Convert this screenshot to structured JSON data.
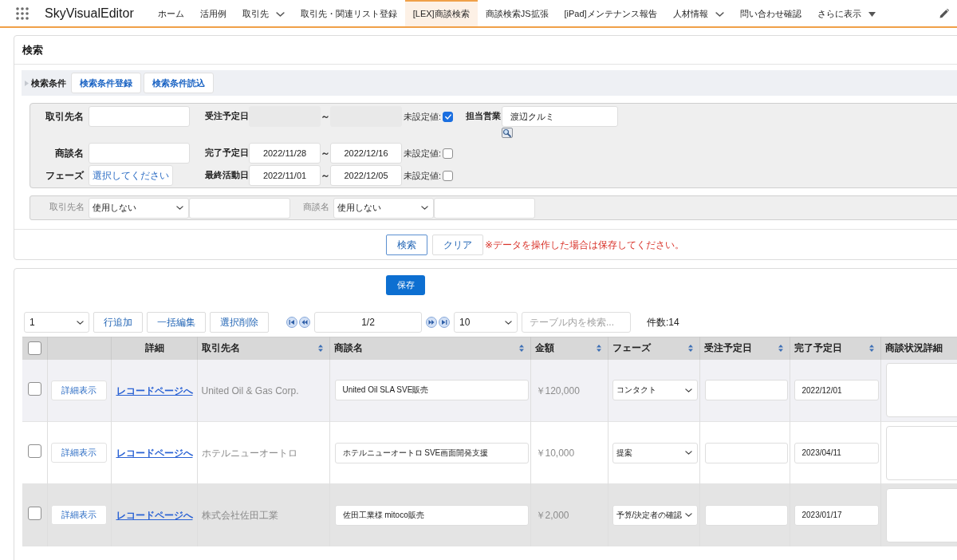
{
  "app": {
    "name": "SkyVisualEditor"
  },
  "nav": [
    {
      "label": "ホーム",
      "kind": "link",
      "selected": false
    },
    {
      "label": "活用例",
      "kind": "link",
      "selected": false
    },
    {
      "label": "取引先",
      "kind": "menu",
      "selected": false
    },
    {
      "label": "取引先・関連リスト登録",
      "kind": "link",
      "selected": false
    },
    {
      "label": "[LEX]商談検索",
      "kind": "link",
      "selected": true
    },
    {
      "label": "商談検索JS拡張",
      "kind": "link",
      "selected": false
    },
    {
      "label": "[iPad]メンテナンス報告",
      "kind": "link",
      "selected": false
    },
    {
      "label": "人材情報",
      "kind": "menu",
      "selected": false
    },
    {
      "label": "問い合わせ確認",
      "kind": "link",
      "selected": false
    },
    {
      "label": "さらに表示",
      "kind": "more",
      "selected": false
    }
  ],
  "search": {
    "title": "検索",
    "conditions": {
      "label": "検索条件",
      "buttons": [
        "検索条件登録",
        "検索条件読込"
      ]
    },
    "fields": [
      {
        "kind": "text",
        "label": "取引先名"
      },
      {
        "kind": "text",
        "label": "商談名"
      },
      {
        "kind": "picker",
        "label": "フェーズ",
        "button": "選択してください"
      }
    ],
    "date_ranges": [
      {
        "label": "受注予定日",
        "disabled": true,
        "separator": "～",
        "unset_label": "未設定値:",
        "unset": true
      },
      {
        "label": "完了予定日",
        "disabled": false,
        "from": "2022/11/28",
        "separator": "～",
        "to": "2022/12/16",
        "unset_label": "未設定値:",
        "unset": false
      },
      {
        "label": "最終活動日",
        "disabled": false,
        "from": "2022/11/01",
        "separator": "～",
        "to": "2022/12/05",
        "unset_label": "未設定値:",
        "unset": false
      }
    ],
    "owner": {
      "label": "担当営業",
      "value": "渡辺クルミ"
    },
    "filters": [
      {
        "label": "取引先名",
        "operator": "使用しない"
      },
      {
        "label": "商談名",
        "operator": "使用しない"
      }
    ],
    "actions": [
      {
        "label": "検索",
        "focused": true
      },
      {
        "label": "クリア",
        "focused": false
      }
    ],
    "notice": "※データを操作した場合は保存してください。"
  },
  "results": {
    "save": "保存",
    "toolbar": {
      "add_count": "1",
      "buttons": [
        "行追加",
        "一括編集",
        "選択削除"
      ],
      "page": "1/2",
      "page_size": "10",
      "search_placeholder": "テーブル内を検索...",
      "count": "件数:14"
    },
    "table": {
      "all_selected": false,
      "columns": [
        {
          "label": "詳細",
          "sortable": false
        },
        {
          "label": "取引先名",
          "sortable": true
        },
        {
          "label": "商談名",
          "sortable": true
        },
        {
          "label": "金額",
          "sortable": true
        },
        {
          "label": "フェーズ",
          "sortable": true
        },
        {
          "label": "受注予定日",
          "sortable": true
        },
        {
          "label": "完了予定日",
          "sortable": true
        },
        {
          "label": "商談状況詳細",
          "sortable": false
        }
      ],
      "rows": [
        {
          "selected": false,
          "hovered": false,
          "detail": "詳細表示",
          "link": "レコードページへ",
          "account": "United Oil & Gas Corp.",
          "name": "United Oil SLA SVE販売",
          "amount": "￥120,000",
          "phase": "コンタクト",
          "close_date": "2022/12/01"
        },
        {
          "selected": false,
          "hovered": false,
          "detail": "詳細表示",
          "link": "レコードページへ",
          "account": "ホテルニューオートロ",
          "name": "ホテルニューオートロ SVE画面開発支援",
          "amount": "￥10,000",
          "phase": "提案",
          "close_date": "2023/04/11"
        },
        {
          "selected": false,
          "hovered": true,
          "detail": "詳細表示",
          "link": "レコードページへ",
          "account": "株式会社佐田工業",
          "name": "佐田工業様 mitoco販売",
          "amount": "￥2,000",
          "phase": "予算/決定者の確認",
          "close_date": "2023/01/17"
        }
      ]
    }
  }
}
